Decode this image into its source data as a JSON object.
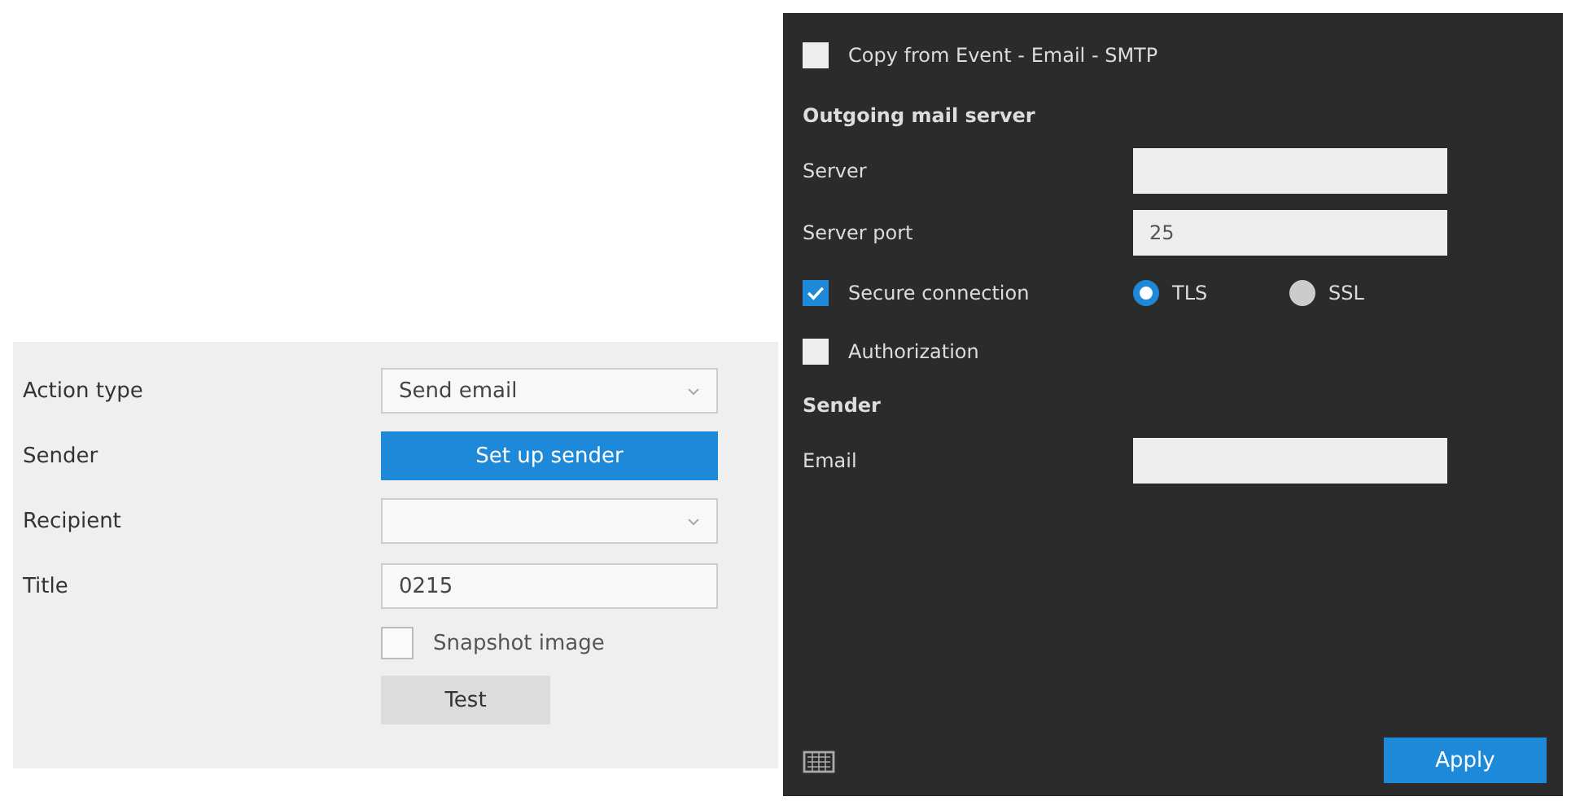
{
  "action_form": {
    "rows": [
      {
        "kind": "dropdown",
        "label": "Action type",
        "value": "Send email"
      },
      {
        "kind": "button",
        "label": "Sender",
        "button": "Set up sender"
      },
      {
        "kind": "dropdown",
        "label": "Recipient"
      },
      {
        "kind": "text",
        "label": "Title",
        "value": "0215"
      },
      {
        "kind": "checkbox",
        "label": "Snapshot image",
        "checked": false
      },
      {
        "kind": "plain_button",
        "button": "Test"
      }
    ]
  },
  "sender_dialog": {
    "copy_option": {
      "label": "Copy from Event - Email - SMTP",
      "checked": false
    },
    "rows": [
      {
        "kind": "heading",
        "label": "Outgoing mail server"
      },
      {
        "kind": "text",
        "label": "Server"
      },
      {
        "kind": "text",
        "label": "Server port",
        "value": "25"
      },
      {
        "kind": "checkbox_radios",
        "label": "Secure connection",
        "checked": true,
        "options": [
          {
            "label": "TLS",
            "selected": true
          },
          {
            "label": "SSL",
            "selected": false
          }
        ]
      },
      {
        "kind": "checkbox",
        "label": "Authorization",
        "checked": false
      },
      {
        "kind": "heading",
        "label": "Sender"
      },
      {
        "kind": "text",
        "label": "Email"
      }
    ],
    "apply_button": "Apply"
  }
}
